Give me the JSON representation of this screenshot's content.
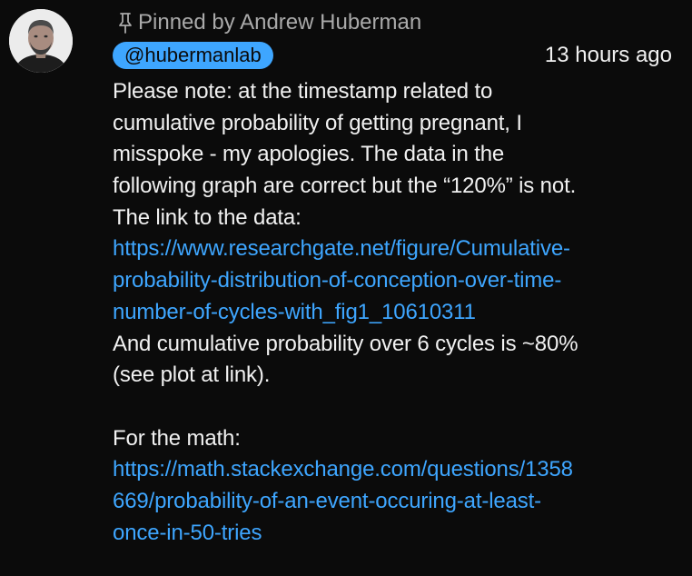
{
  "pinned": {
    "label": "Pinned by Andrew Huberman"
  },
  "author": {
    "handle": "@hubermanlab",
    "timestamp": "13 hours ago"
  },
  "comment": {
    "line1": "Please note: at the timestamp related to",
    "line2": "cumulative probability of getting pregnant, I",
    "line3": "misspoke - my apologies. The data in the",
    "line4": "following graph are correct but the “120%” is not.",
    "line5": "The link to the data:",
    "link1_line1": "https://www.researchgate.net/figure/Cumulative-",
    "link1_line2": "probability-distribution-of-conception-over-time-",
    "link1_line3": "number-of-cycles-with_fig1_10610311",
    "line6": "And cumulative probability over 6 cycles is ~80%",
    "line7": "(see plot at link).",
    "line8": "For the math:",
    "link2_line1": "https://math.stackexchange.com/questions/1358",
    "link2_line2": "669/probability-of-an-event-occuring-at-least-",
    "link2_line3": "once-in-50-tries"
  },
  "colors": {
    "background": "#0b0b0b",
    "text": "#f1f1f1",
    "muted": "#aaaaaa",
    "link": "#3ea6ff",
    "badge": "#3ea6ff"
  },
  "icons": {
    "avatar": "avatar-photo",
    "pin": "pin-icon"
  }
}
